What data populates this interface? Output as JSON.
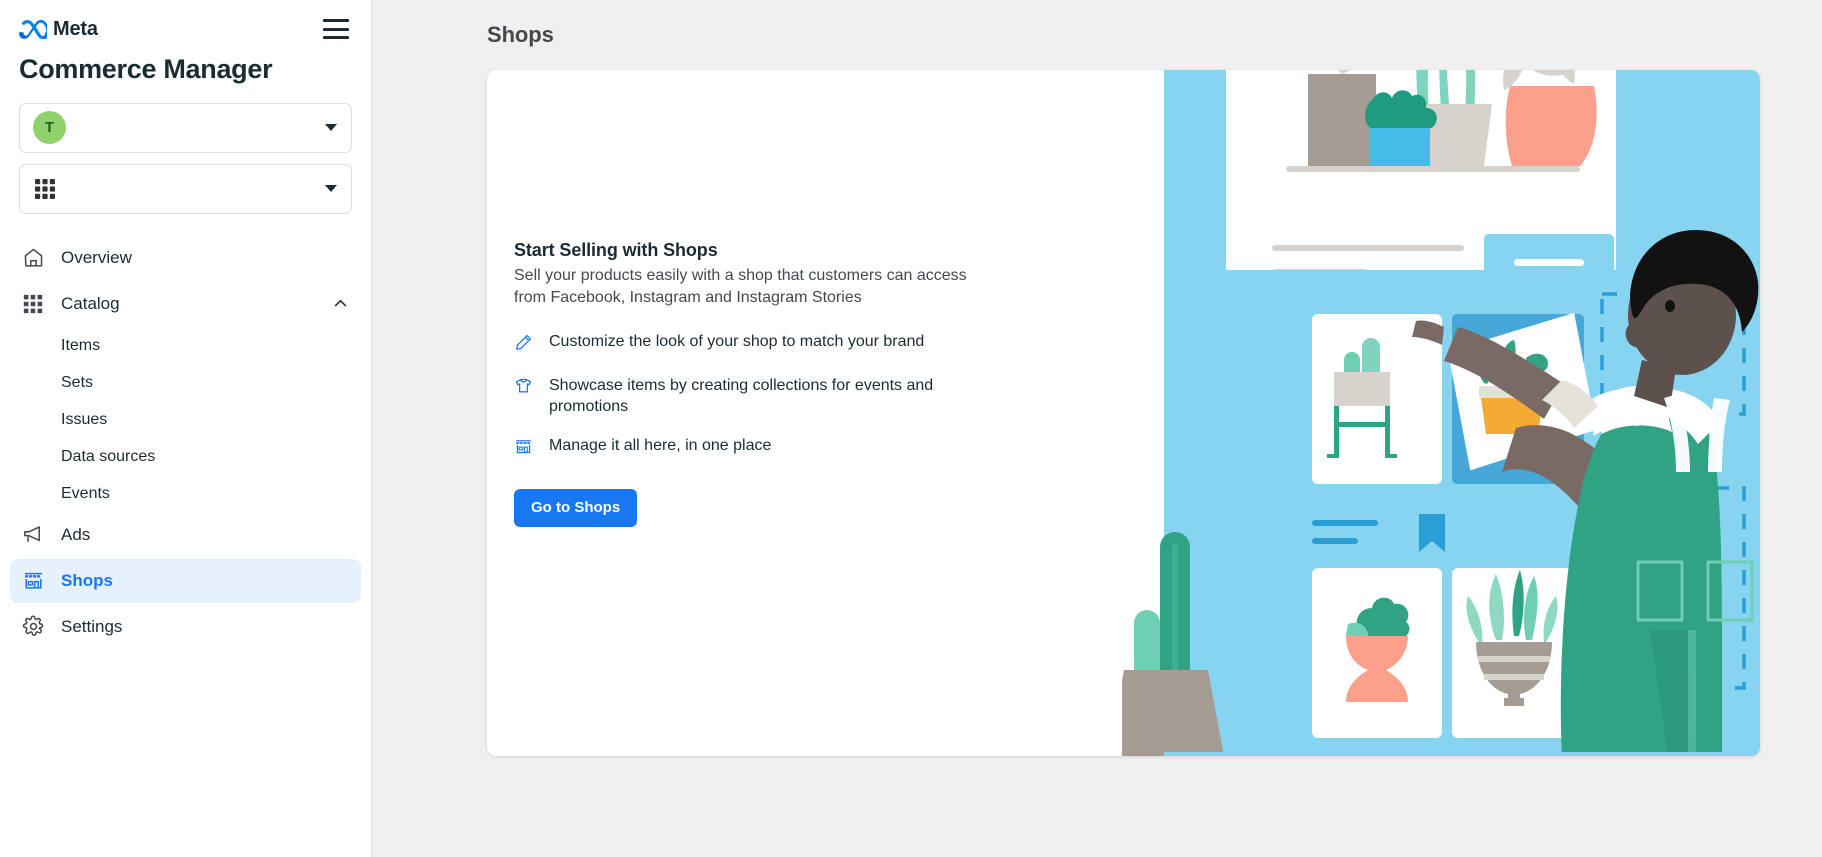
{
  "brand": {
    "logo_text": "Meta",
    "product_title": "Commerce Manager",
    "menu_icon": "hamburger-icon"
  },
  "sidebar": {
    "business_selector": {
      "avatar_initial": "T",
      "label": "",
      "caret_icon": "chevron-down-icon"
    },
    "catalog_selector": {
      "icon": "grid-icon",
      "label": "",
      "caret_icon": "chevron-down-icon"
    },
    "nav": [
      {
        "label": "Overview",
        "icon": "home-icon",
        "active": false
      },
      {
        "label": "Catalog",
        "icon": "grid-icon",
        "active": false,
        "expanded": true,
        "children": [
          {
            "label": "Items"
          },
          {
            "label": "Sets"
          },
          {
            "label": "Issues"
          },
          {
            "label": "Data sources"
          },
          {
            "label": "Events"
          }
        ]
      },
      {
        "label": "Ads",
        "icon": "megaphone-icon",
        "active": false
      },
      {
        "label": "Shops",
        "icon": "storefront-icon",
        "active": true
      },
      {
        "label": "Settings",
        "icon": "gear-icon",
        "active": false
      }
    ]
  },
  "main": {
    "page_title": "Shops",
    "promo": {
      "title": "Start Selling with Shops",
      "subtitle": "Sell your products easily with a shop that customers can access from Facebook, Instagram and Instagram Stories",
      "features": [
        {
          "icon": "pencil-icon",
          "text": "Customize the look of your shop to match your brand"
        },
        {
          "icon": "tshirt-icon",
          "text": "Showcase items by creating collections for events and promotions"
        },
        {
          "icon": "storefront-icon",
          "text": "Manage it all here, in one place"
        }
      ],
      "cta_label": "Go to Shops"
    },
    "illustration": {
      "name": "shops-hero-illustration",
      "alt": "Person arranging plant product cards on a shop wall"
    }
  },
  "colors": {
    "accent_blue": "#1877f2",
    "active_nav_bg": "#e7f0fd",
    "page_bg": "#f0f0f0",
    "illustration_bg": "#86d4ef",
    "avatar_green": "#8fd16a",
    "overall_green": "#2fa383"
  }
}
